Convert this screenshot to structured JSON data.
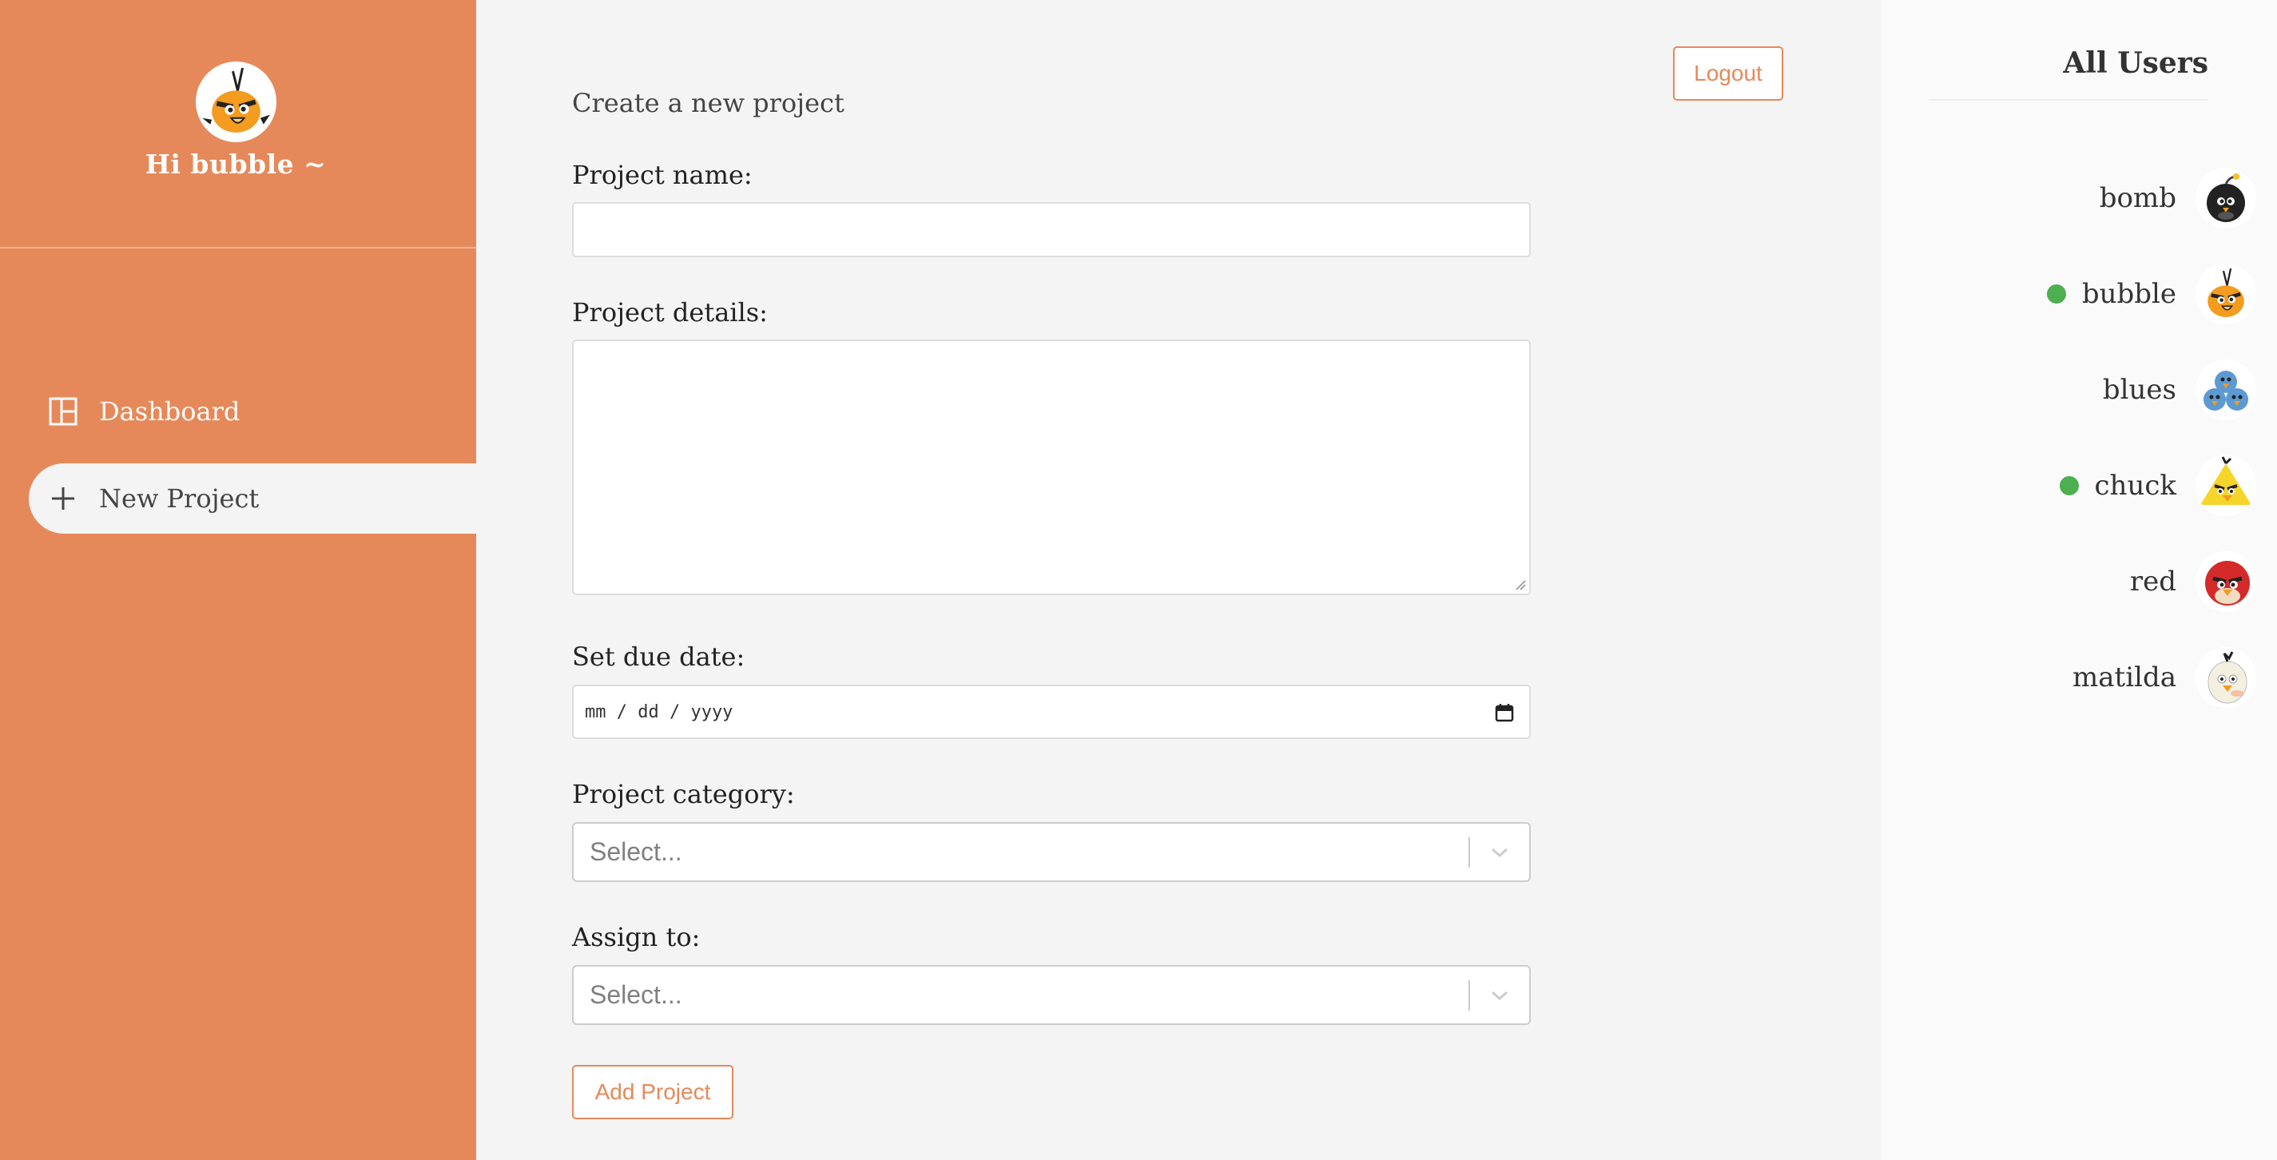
{
  "sidebar": {
    "greeting": "Hi bubble ~",
    "nav": [
      {
        "label": "Dashboard",
        "icon": "dashboard-icon"
      },
      {
        "label": "New Project",
        "icon": "plus-icon"
      }
    ],
    "accent": "#e6895a"
  },
  "header": {
    "logout_label": "Logout"
  },
  "form": {
    "title": "Create a new project",
    "name_label": "Project name:",
    "details_label": "Project details:",
    "due_label": "Set due date:",
    "due_placeholder": "mm / dd / yyyy",
    "category_label": "Project category:",
    "category_value": "Select...",
    "assign_label": "Assign to:",
    "assign_value": "Select...",
    "submit_label": "Add Project"
  },
  "users_panel": {
    "title": "All Users",
    "users": [
      {
        "name": "bomb",
        "online": false,
        "avatar": "bomb-bird-icon"
      },
      {
        "name": "bubble",
        "online": true,
        "avatar": "bubble-bird-icon"
      },
      {
        "name": "blues",
        "online": false,
        "avatar": "blues-bird-icon"
      },
      {
        "name": "chuck",
        "online": true,
        "avatar": "chuck-bird-icon"
      },
      {
        "name": "red",
        "online": false,
        "avatar": "red-bird-icon"
      },
      {
        "name": "matilda",
        "online": false,
        "avatar": "matilda-bird-icon"
      }
    ],
    "online_color": "#4caf50"
  }
}
